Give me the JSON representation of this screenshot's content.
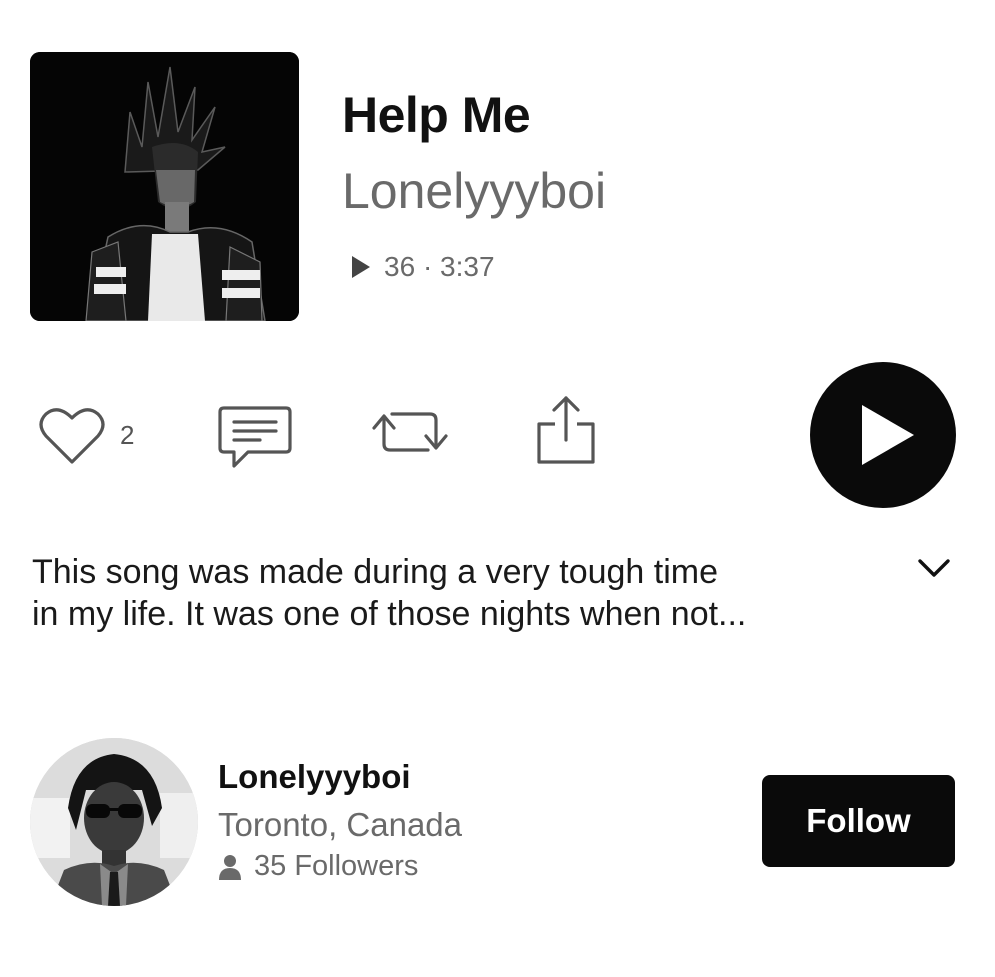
{
  "track": {
    "title": "Help Me",
    "artist": "Lonelyyyboi",
    "plays": "36",
    "separator": "·",
    "duration": "3:37",
    "cover_icon": "anime-character-artwork"
  },
  "actions": {
    "like_icon": "heart-icon",
    "like_count": "2",
    "comment_icon": "comment-icon",
    "repost_icon": "repost-icon",
    "share_icon": "share-icon",
    "play_icon": "play-icon"
  },
  "description": {
    "lines": [
      "This song was made during a very tough time",
      "in my life. It was one of those nights when not..."
    ],
    "expand_icon": "chevron-down-icon"
  },
  "artist_card": {
    "name": "Lonelyyyboi",
    "location": "Toronto, Canada",
    "followers": "35 Followers",
    "followers_icon": "person-icon",
    "follow_label": "Follow"
  },
  "colors": {
    "primary_text": "#111111",
    "secondary_text": "#6a6a6a",
    "button_bg": "#0a0a0a",
    "button_text": "#ffffff",
    "background": "#ffffff"
  }
}
